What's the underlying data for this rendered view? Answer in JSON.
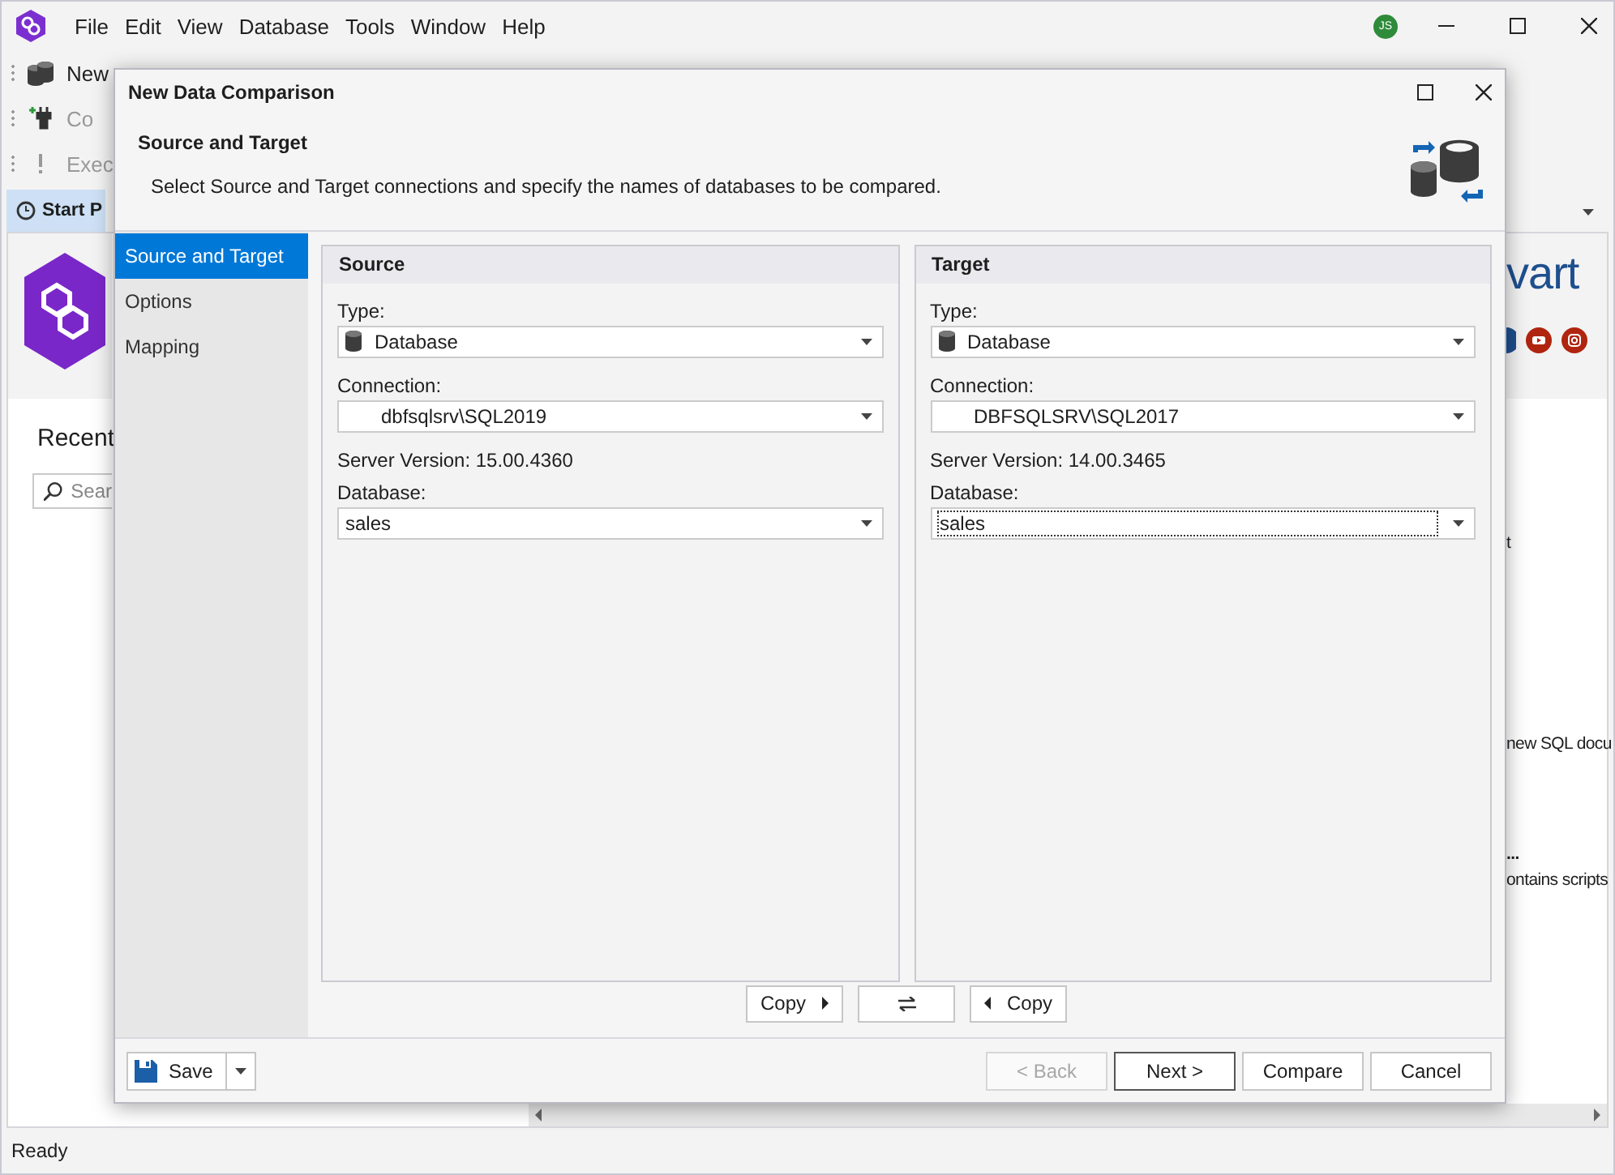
{
  "app": {
    "menu": [
      {
        "label": "File"
      },
      {
        "label": "Edit"
      },
      {
        "label": "View"
      },
      {
        "label": "Database"
      },
      {
        "label": "Tools"
      },
      {
        "label": "Window"
      },
      {
        "label": "Help"
      }
    ],
    "user_initials": "JS",
    "toolbar": [
      {
        "label": "New",
        "disabled": false
      },
      {
        "label": "Co",
        "disabled": true
      },
      {
        "label": "Exec",
        "disabled": true
      }
    ],
    "document_tab": {
      "label": "Start P",
      "selected": true
    },
    "start_page": {
      "brand_text": "vart",
      "recent_title": "Recent",
      "search": {
        "placeholder": "Sear"
      },
      "snippets": [
        {
          "text": "t",
          "kind": "plain"
        },
        {
          "text": "new SQL docu",
          "kind": "plain"
        },
        {
          "text": "...",
          "kind": "bold"
        },
        {
          "text": "ontains scripts",
          "kind": "plain"
        }
      ]
    },
    "status_bar": "Ready"
  },
  "dialog": {
    "title": "New Data Comparison",
    "header": {
      "title": "Source and Target",
      "description": "Select Source and Target connections and specify the names of databases to be compared."
    },
    "nav": [
      {
        "label": "Source and Target",
        "selected": true
      },
      {
        "label": "Options",
        "selected": false
      },
      {
        "label": "Mapping",
        "selected": false
      }
    ],
    "panels": [
      {
        "title": "Source",
        "type_label": "Type:",
        "type_value": "Database",
        "connection_label": "Connection:",
        "connection_value": "dbfsqlsrv\\SQL2019",
        "server_version": "Server Version: 15.00.4360",
        "database_label": "Database:",
        "database_value": "sales",
        "focused": false
      },
      {
        "title": "Target",
        "type_label": "Type:",
        "type_value": "Database",
        "connection_label": "Connection:",
        "connection_value": "DBFSQLSRV\\SQL2017",
        "server_version": "Server Version: 14.00.3465",
        "database_label": "Database:",
        "database_value": "sales",
        "focused": true
      }
    ],
    "copy_buttons": [
      {
        "kind": "copy-right",
        "label": "Copy"
      },
      {
        "kind": "swap"
      },
      {
        "kind": "copy-left",
        "label": "Copy"
      }
    ],
    "save_button": "Save",
    "buttons": [
      {
        "label": "< Back",
        "disabled": true,
        "default": false
      },
      {
        "label": "Next >",
        "disabled": false,
        "default": true
      },
      {
        "label": "Compare",
        "disabled": false,
        "default": false
      },
      {
        "label": "Cancel",
        "disabled": false,
        "default": false
      }
    ]
  }
}
